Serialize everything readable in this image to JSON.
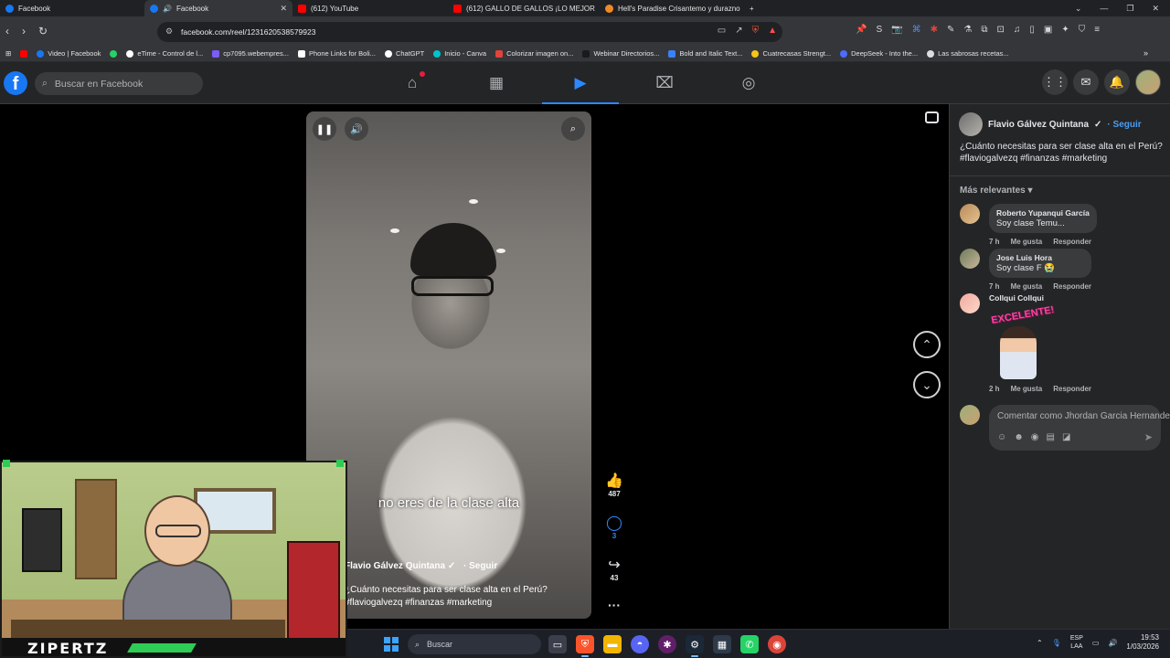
{
  "browser": {
    "tabs": [
      {
        "label": "Facebook",
        "favicon": "facebook-icon"
      },
      {
        "label": "Facebook",
        "favicon": "facebook-icon",
        "audio": true
      },
      {
        "label": "(612) YouTube",
        "favicon": "youtube-icon"
      },
      {
        "label": "(612) GALLO DE GALLOS ¡LO MEJOR",
        "favicon": "youtube-icon"
      },
      {
        "label": "Hell's Paradise Crisantemo y durazno",
        "favicon": "firefox-icon"
      }
    ],
    "new_tab": "+",
    "url": "facebook.com/reel/1231620538579923",
    "bookmarks": [
      {
        "label": "",
        "color": "#ff0000"
      },
      {
        "label": "Video | Facebook",
        "color": "#1877f2"
      },
      {
        "label": "",
        "color": "#25d366"
      },
      {
        "label": "eTime - Control de l...",
        "color": "#ffffff"
      },
      {
        "label": "cp7095.webempres...",
        "color": "#7b5cff"
      },
      {
        "label": "Phone Links for Boli...",
        "color": "#ffffff"
      },
      {
        "label": "ChatGPT",
        "color": "#ffffff"
      },
      {
        "label": "Inicio - Canva",
        "color": "#00c4cc"
      },
      {
        "label": "Colorizar imagen on...",
        "color": "#e0443a"
      },
      {
        "label": "Webinar Directorios...",
        "color": "#1a1a1a"
      },
      {
        "label": "Bold and Italic Text...",
        "color": "#3b82f6"
      },
      {
        "label": "Cuatrecasas Strengt...",
        "color": "#f5c518"
      },
      {
        "label": "DeepSeek - Into the...",
        "color": "#4d6bfe"
      },
      {
        "label": "Las sabrosas recetas...",
        "color": "#dddddd"
      }
    ]
  },
  "facebook": {
    "search_placeholder": "Buscar en Facebook",
    "nav": [
      "home-icon",
      "pages-icon",
      "reels-icon",
      "marketplace-icon",
      "groups-icon"
    ],
    "active_nav": "reels-icon"
  },
  "reel": {
    "subtitle": "no eres de la clase alta",
    "author": "Flavio Gálvez Quintana",
    "follow": "· Seguir",
    "caption": "¿Cuánto necesitas para ser clase alta en el Perú? #flaviogalvezq #finanzas #marketing",
    "likes": "487",
    "comments": "3",
    "shares": "43"
  },
  "panel": {
    "author": "Flavio Gálvez Quintana",
    "follow": "· Seguir",
    "caption": "¿Cuánto necesitas para ser clase alta en el Perú? #flaviogalvezq #finanzas #marketing",
    "sort_label": "Más relevantes",
    "comments": [
      {
        "name": "Roberto Yupanqui García",
        "text": "Soy clase Temu...",
        "time": "7 h",
        "like": "Me gusta",
        "reply": "Responder"
      },
      {
        "name": "Jose Luis Hora",
        "text": "Soy clase F 😭",
        "time": "7 h",
        "like": "Me gusta",
        "reply": "Responder"
      },
      {
        "name": "Collqui Collqui",
        "text": "",
        "sticker_text": "EXCELENTE!",
        "time": "2 h",
        "like": "Me gusta",
        "reply": "Responder"
      }
    ],
    "comment_placeholder": "Comentar como Jhordan Garcia Hernandez"
  },
  "overlay": {
    "cam_name": "ZIPERTZ"
  },
  "taskbar": {
    "search_placeholder": "Buscar",
    "apps": [
      {
        "icon": "task-view-icon",
        "color": "#3a3f4b"
      },
      {
        "icon": "brave-icon",
        "color": "#fb542b",
        "active": true
      },
      {
        "icon": "file-explorer-icon",
        "color": "#f2b600"
      },
      {
        "icon": "discord-icon",
        "color": "#5865f2"
      },
      {
        "icon": "slack-icon",
        "color": "#611f69"
      },
      {
        "icon": "steam-icon",
        "color": "#1b2838",
        "active": true
      },
      {
        "icon": "calculator-icon",
        "color": "#2e3a4a"
      },
      {
        "icon": "whatsapp-icon",
        "color": "#25d366"
      },
      {
        "icon": "chrome-icon",
        "color": "#db4437"
      }
    ],
    "lang_top": "ESP",
    "lang_bottom": "LAA",
    "time": "19:53",
    "date": "1/03/2026"
  }
}
